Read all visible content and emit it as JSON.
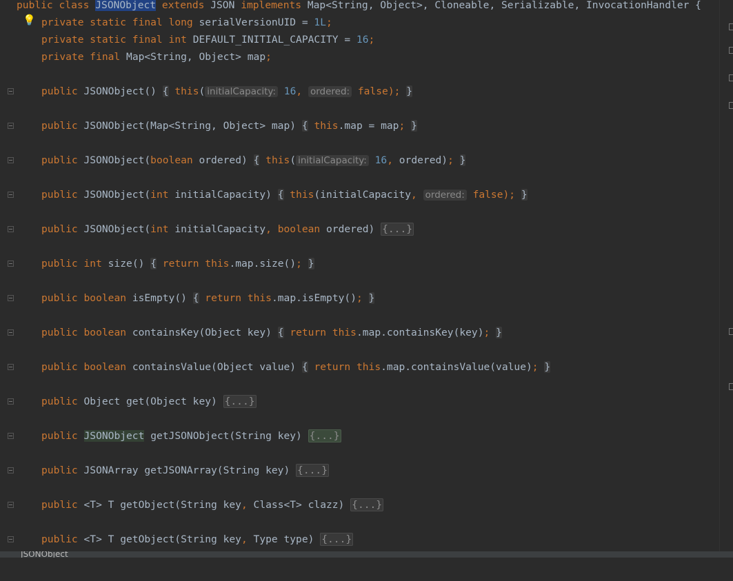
{
  "editor": {
    "class_decl": {
      "public": "public",
      "class": "class",
      "name": "JSONObject",
      "extends": "extends",
      "parent": "JSON",
      "implements": "implements",
      "interfaces": "Map<String, Object>, Cloneable, Serializable, InvocationHandler {"
    },
    "fields": [
      {
        "mods": "private static final",
        "type": "long",
        "name": "serialVersionUID = ",
        "value": "1L",
        "end": ";"
      },
      {
        "mods": "private static final",
        "type": "int",
        "name": "DEFAULT_INITIAL_CAPACITY = ",
        "value": "16",
        "end": ";"
      },
      {
        "mods": "private final",
        "type": "",
        "name": "Map<String, Object> map",
        "value": "",
        "end": ";"
      }
    ],
    "ctor1": {
      "public": "public",
      "sig": "JSONObject()",
      "open": "{",
      "this": "this",
      "paren": "(",
      "hint1": "initialCapacity:",
      "v1": "16",
      "comma": ",",
      "hint2": "ordered:",
      "v2": "false",
      "tail": ");",
      "close": "}"
    },
    "ctor2": {
      "public": "public",
      "sig": "JSONObject(Map<String, Object> map)",
      "open": "{",
      "this": "this",
      "rest": ".map = map",
      "semi": ";",
      "close": "}"
    },
    "ctor3": {
      "public": "public",
      "sig1": "JSONObject(",
      "bool": "boolean",
      "sig2": " ordered)",
      "open": "{",
      "this": "this",
      "paren": "(",
      "hint1": "initialCapacity:",
      "v1": "16",
      "comma": ",",
      "rest": " ordered)",
      "semi": ";",
      "close": "}"
    },
    "ctor4": {
      "public": "public",
      "sig1": "JSONObject(",
      "int": "int",
      "sig2": " initialCapacity)",
      "open": "{",
      "this": "this",
      "rest": "(initialCapacity",
      "comma": ",",
      "hint2": "ordered:",
      "v2": "false",
      "tail": ");",
      "close": "}"
    },
    "ctor5": {
      "public": "public",
      "sig1": "JSONObject(",
      "int": "int",
      "sig2": " initialCapacity",
      "comma": ",",
      "bool": "boolean",
      "sig3": " ordered)",
      "folded": "{...}"
    },
    "m_size": {
      "public": "public",
      "type": "int",
      "sig": "size()",
      "open": "{",
      "ret": "return",
      "this": "this",
      "rest": ".map.size()",
      "semi": ";",
      "close": "}"
    },
    "m_isEmpty": {
      "public": "public",
      "type": "boolean",
      "sig": "isEmpty()",
      "open": "{",
      "ret": "return",
      "this": "this",
      "rest": ".map.isEmpty()",
      "semi": ";",
      "close": "}"
    },
    "m_containsKey": {
      "public": "public",
      "type": "boolean",
      "sig": "containsKey(Object key)",
      "open": "{",
      "ret": "return",
      "this": "this",
      "rest": ".map.containsKey(key)",
      "semi": ";",
      "close": "}"
    },
    "m_containsValue": {
      "public": "public",
      "type": "boolean",
      "sig": "containsValue(Object value)",
      "open": "{",
      "ret": "return",
      "this": "this",
      "rest": ".map.containsValue(value)",
      "semi": ";",
      "close": "}"
    },
    "m_get": {
      "public": "public",
      "sig": "Object get(Object key)",
      "folded": "{...}"
    },
    "m_getJSONObject": {
      "public": "public",
      "type": "JSONObject",
      "sig": "getJSONObject(String key)",
      "folded": "{...}"
    },
    "m_getJSONArray": {
      "public": "public",
      "sig": "JSONArray getJSONArray(String key)",
      "folded": "{...}"
    },
    "m_getObject1": {
      "public": "public",
      "sig1": "<T> T getObject(String key",
      "comma": ",",
      "sig2": " Class<T> clazz)",
      "folded": "{...}"
    },
    "m_getObject2": {
      "public": "public",
      "sig1": "<T> T getObject(String key",
      "comma": ",",
      "sig2": " Type type)",
      "folded": "{...}"
    }
  },
  "bottom_tab": {
    "label": "JSONObject"
  },
  "icons": {
    "intention": "lightbulb-icon",
    "fold": "fold-toggle-icon"
  },
  "colors": {
    "background": "#2b2b2b",
    "keyword": "#cc7832",
    "number": "#6897bb",
    "text": "#a9b7c6",
    "selection": "#214283"
  }
}
